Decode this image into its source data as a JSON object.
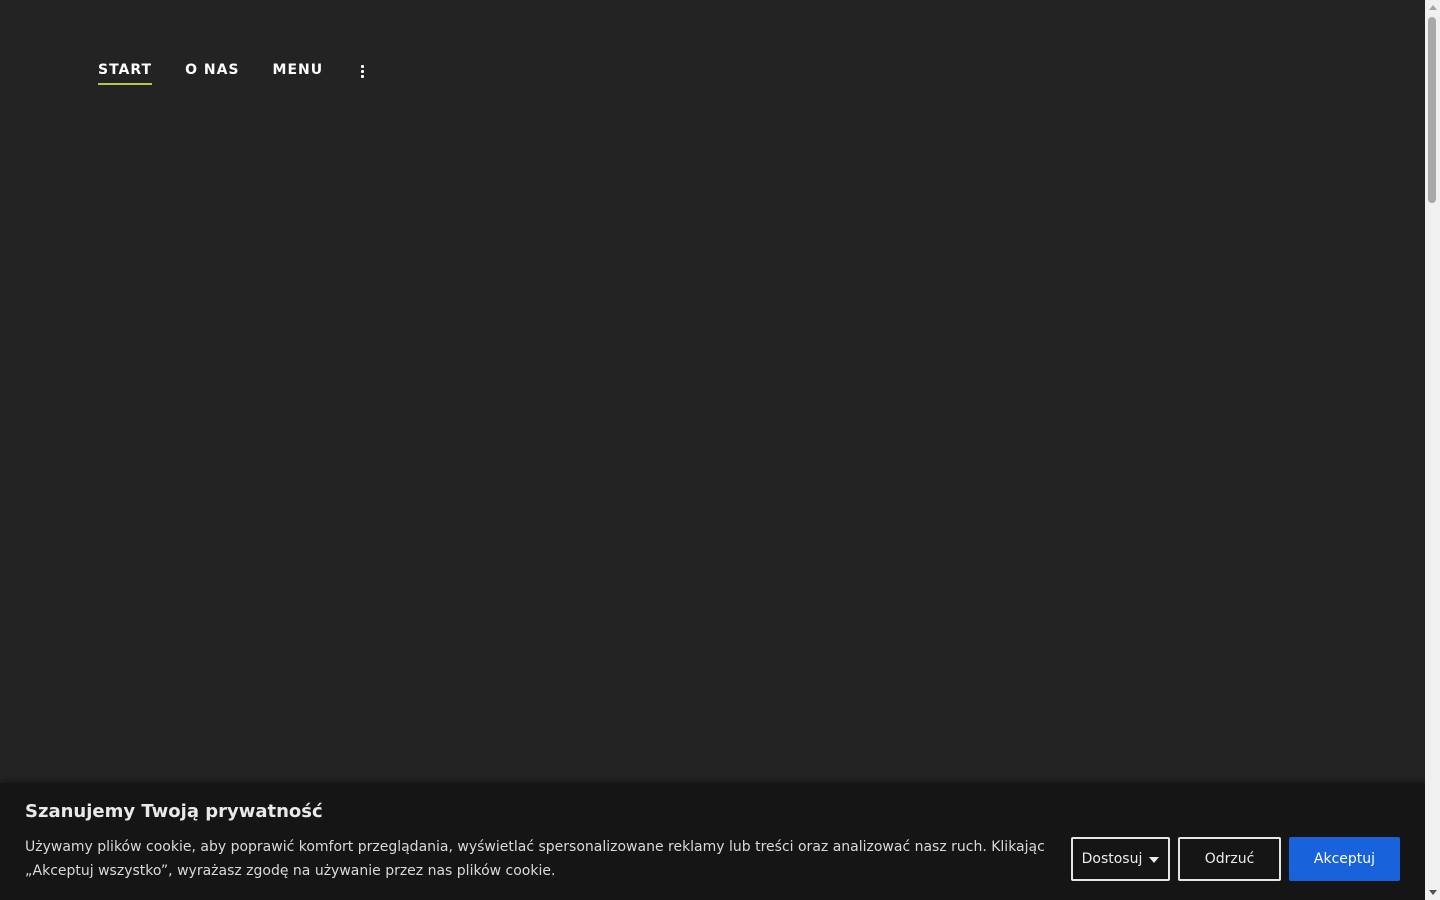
{
  "nav": {
    "items": [
      {
        "label": "START",
        "active": true
      },
      {
        "label": "O NAS",
        "active": false
      },
      {
        "label": "MENU",
        "active": false
      }
    ],
    "more_icon": "more-vertical-icon",
    "active_underline_color": "#b8c34a"
  },
  "cookie_banner": {
    "title": "Szanujemy Twoją prywatność",
    "text": "Używamy plików cookie, aby poprawić komfort przeglądania, wyświetlać spersonalizowane reklamy lub treści oraz analizować nasz ruch. Klikając „Akceptuj wszystko”, wyrażasz zgodę na używanie przez nas plików cookie.",
    "buttons": {
      "customize": "Dostosuj",
      "reject": "Odrzuć",
      "accept": "Akceptuj"
    },
    "accept_color": "#1863dc"
  },
  "theme": {
    "background": "#232323",
    "banner_background": "#151515"
  }
}
